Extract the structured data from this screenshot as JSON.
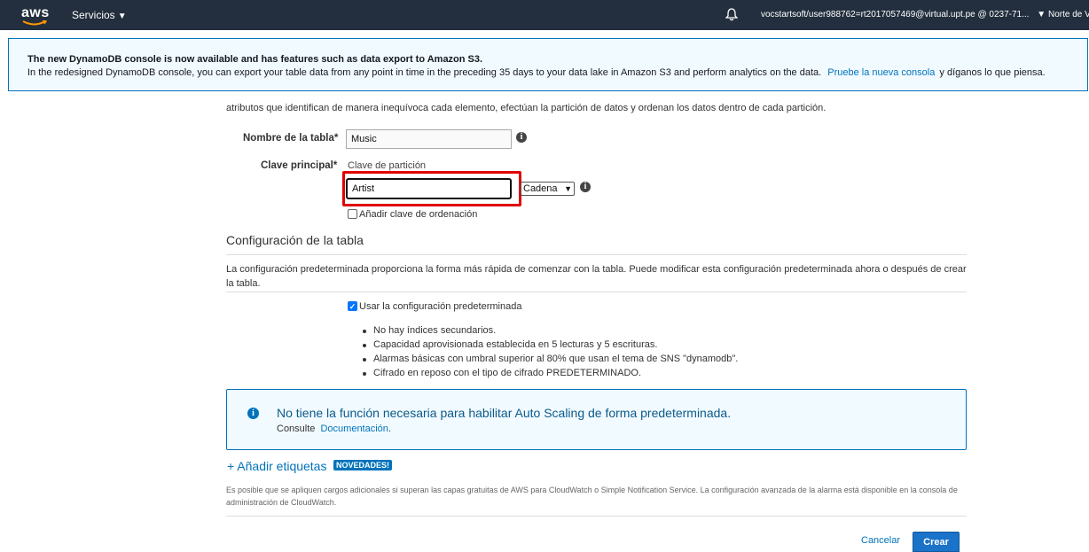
{
  "topbar": {
    "logo": "aws",
    "services": "Servicios",
    "account": "vocstartsoft/user988762=rt2017057469@virtual.upt.pe @ 0237-71...",
    "region": "Norte de V"
  },
  "banner": {
    "title": "The new DynamoDB console is now available and has features such as data export to Amazon S3.",
    "text": "In the redesigned DynamoDB console, you can export your table data from any point in time in the preceding 35 days to your data lake in Amazon S3 and perform analytics on the data.",
    "link": "Pruebe la nueva consola",
    "tail": "y díganos lo que piensa."
  },
  "form": {
    "intro": "atributos que identifican de manera inequívoca cada elemento, efectúan la partición de datos y ordenan los datos dentro de cada partición.",
    "table_name_label": "Nombre de la tabla*",
    "table_name_value": "Music",
    "primary_key_label": "Clave principal*",
    "partition_key_label": "Clave de partición",
    "partition_key_value": "Artist",
    "type_selected": "Cadena",
    "sort_key_label": "Añadir clave de ordenación"
  },
  "config": {
    "title": "Configuración de la tabla",
    "description": "La configuración predeterminada proporciona la forma más rápida de comenzar con la tabla. Puede modificar esta configuración predeterminada ahora o después de crear la tabla.",
    "default_checkbox_label": "Usar la configuración predeterminada",
    "bullets": [
      "No hay índices secundarios.",
      "Capacidad aprovisionada establecida en 5 lecturas y 5 escrituras.",
      "Alarmas básicas con umbral superior al 80% que usan el tema de SNS \"dynamodb\".",
      "Cifrado en reposo con el tipo de cifrado PREDETERMINADO."
    ]
  },
  "alert": {
    "title": "No tiene la función necesaria para habilitar Auto Scaling de forma predeterminada.",
    "prefix": "Consulte",
    "link": "Documentación",
    "suffix": "."
  },
  "tags": {
    "link": "+ Añadir etiquetas",
    "badge": "NOVEDADES!"
  },
  "fine_print": "Es posible que se apliquen cargos adicionales si superan las capas gratuitas de AWS para CloudWatch o Simple Notification Service. La configuración avanzada de la alarma está disponible en la consola de administración de CloudWatch.",
  "footer": {
    "cancel": "Cancelar",
    "create": "Crear"
  }
}
